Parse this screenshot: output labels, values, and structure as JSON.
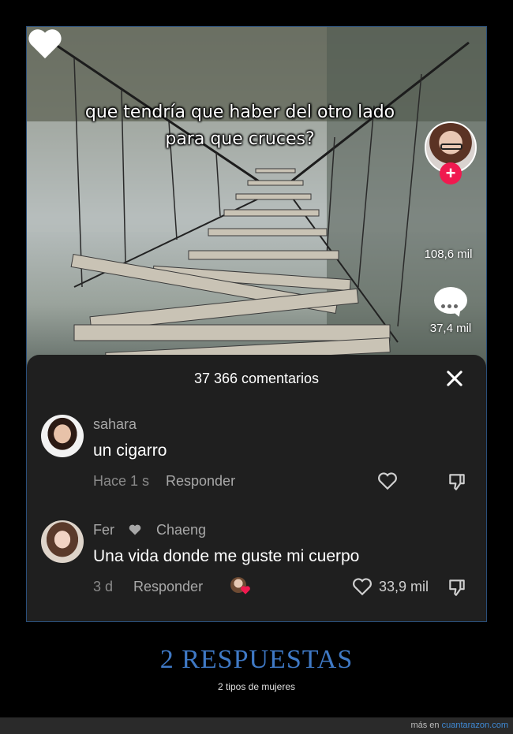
{
  "video": {
    "caption": "que tendría que haber del otro lado para que cruces?",
    "likes": "108,6 mil",
    "comments": "37,4 mil"
  },
  "sheet": {
    "title": "37 366 comentarios"
  },
  "comments": [
    {
      "user": "sahara",
      "text": "un cigarro",
      "time": "Hace 1 s",
      "reply_label": "Responder"
    },
    {
      "user": "Fer",
      "liked_by": "Chaeng",
      "text": "Una vida donde me guste mi cuerpo",
      "time": "3 d",
      "reply_label": "Responder",
      "likes": "33,9 mil"
    }
  ],
  "meme": {
    "title": "2 RESPUESTAS",
    "subtitle": "2 tipos de mujeres"
  },
  "credit": {
    "prefix": "más en",
    "site": "cuantarazon.com"
  },
  "colors": {
    "accent_blue": "#3f79c5",
    "follow_pink": "#f0194f",
    "sheet_bg": "#1f1f1f"
  },
  "icons": [
    "close-icon",
    "heart-icon",
    "comment-bubble-icon",
    "dislike-icon",
    "plus-icon"
  ]
}
